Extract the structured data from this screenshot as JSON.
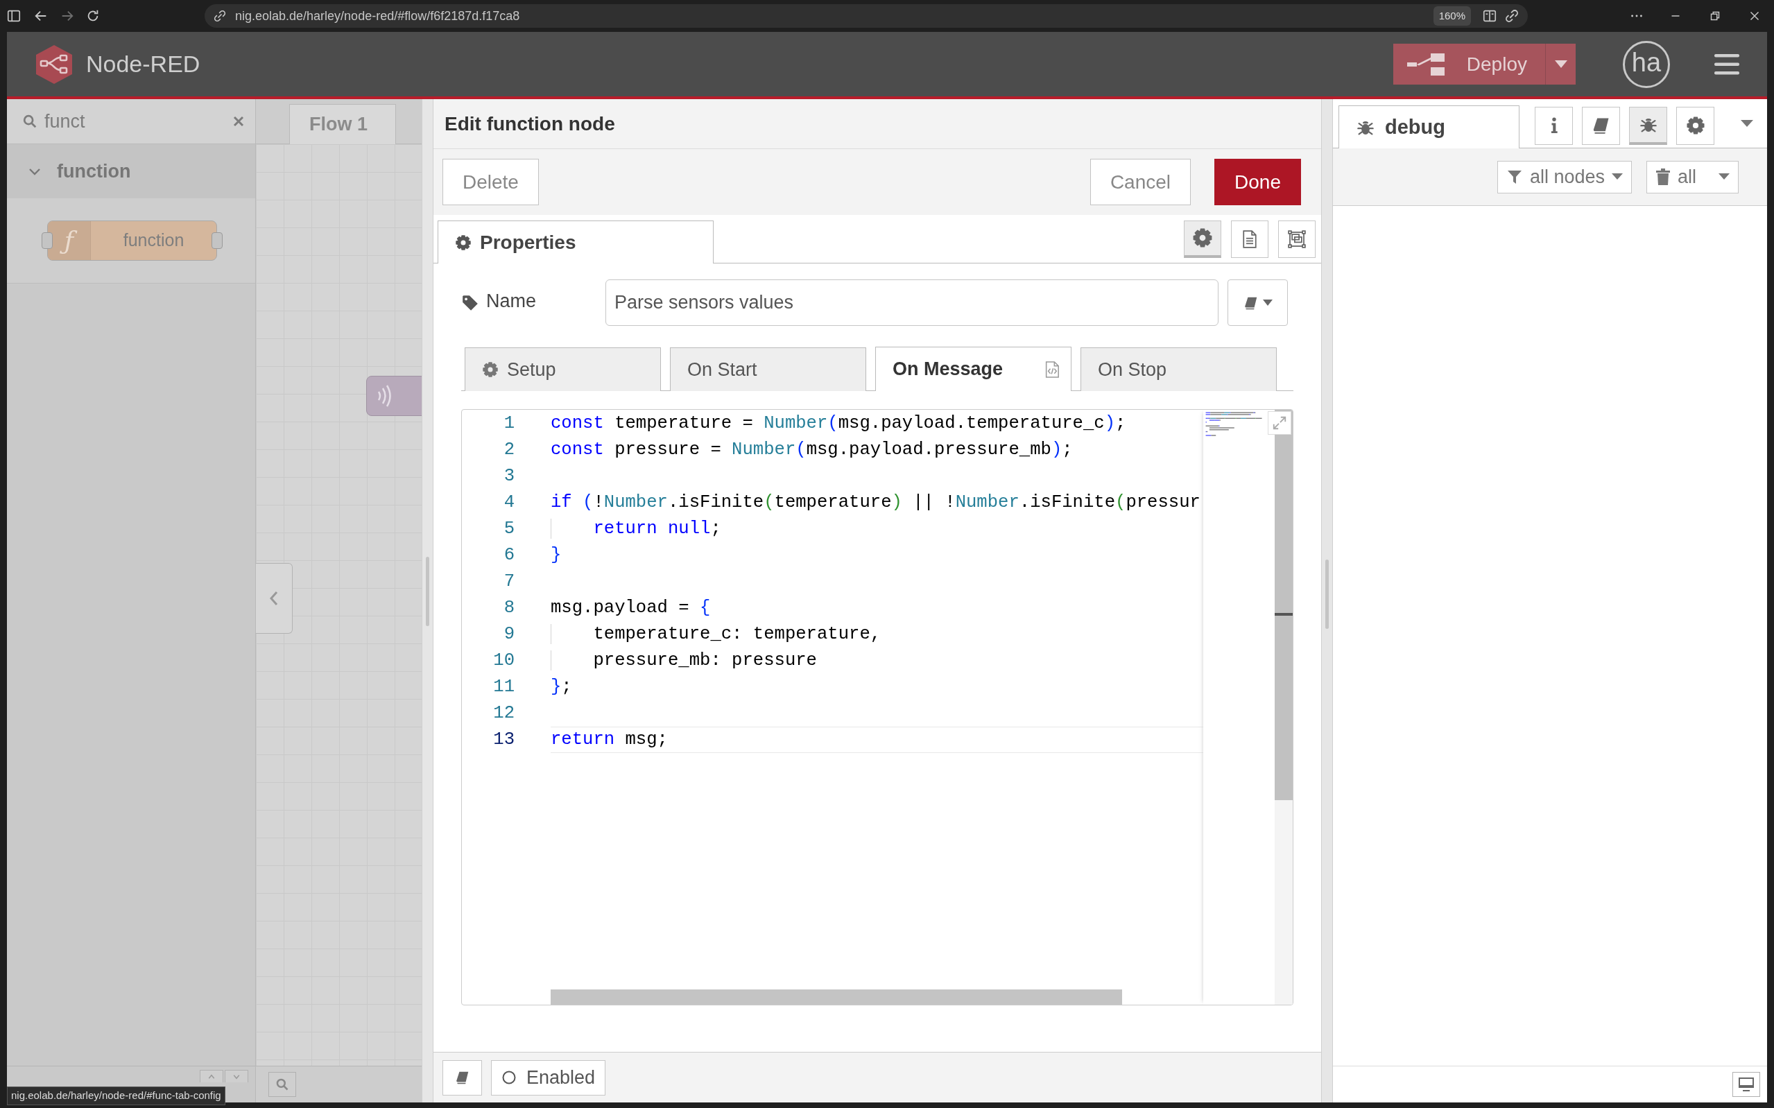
{
  "browser": {
    "url": "nig.eolab.de/harley/node-red/#flow/f6f2187d.f17ca8",
    "zoom": "160%",
    "status_url": "nig.eolab.de/harley/node-red/#func-tab-config"
  },
  "header": {
    "title": "Node-RED",
    "deploy": "Deploy",
    "user": "ha"
  },
  "palette": {
    "search": {
      "value": "funct"
    },
    "categories": [
      {
        "label": "function",
        "expanded": true,
        "nodes": [
          {
            "label": "function",
            "icon": "ƒ"
          }
        ]
      }
    ]
  },
  "workspace": {
    "tabs": [
      {
        "label": "Flow 1",
        "selected": true
      }
    ]
  },
  "tray": {
    "title": "Edit function node",
    "buttons_left": [
      {
        "label": "Delete",
        "kind": "default"
      }
    ],
    "buttons_right": [
      {
        "label": "Cancel",
        "kind": "default"
      },
      {
        "label": "Done",
        "kind": "primary"
      }
    ],
    "tabs": [
      {
        "label": "Properties",
        "selected": true
      }
    ],
    "tool_tabs": [
      {
        "kind": "gear",
        "selected": true
      },
      {
        "kind": "document",
        "selected": false
      },
      {
        "kind": "frame",
        "selected": false
      }
    ],
    "name": {
      "label": "Name",
      "value": "Parse sensors values"
    },
    "subtabs": [
      {
        "label": "Setup",
        "kind": "gear",
        "selected": false
      },
      {
        "label": "On Start",
        "kind": "plain",
        "selected": false
      },
      {
        "label": "On Message",
        "kind": "code",
        "selected": true
      },
      {
        "label": "On Stop",
        "kind": "plain",
        "selected": false
      }
    ],
    "editor": {
      "lines": [
        {
          "number": "1",
          "current": false,
          "tokens": [
            {
              "kind": "keyword",
              "text": "const"
            },
            {
              "kind": "plain",
              "text": " temperature = "
            },
            {
              "kind": "type",
              "text": "Number"
            },
            {
              "kind": "bracket1",
              "text": "("
            },
            {
              "kind": "plain",
              "text": "msg.payload.temperature_c"
            },
            {
              "kind": "bracket1",
              "text": ")"
            },
            {
              "kind": "plain",
              "text": ";"
            }
          ]
        },
        {
          "number": "2",
          "current": false,
          "tokens": [
            {
              "kind": "keyword",
              "text": "const"
            },
            {
              "kind": "plain",
              "text": " pressure = "
            },
            {
              "kind": "type",
              "text": "Number"
            },
            {
              "kind": "bracket1",
              "text": "("
            },
            {
              "kind": "plain",
              "text": "msg.payload.pressure_mb"
            },
            {
              "kind": "bracket1",
              "text": ")"
            },
            {
              "kind": "plain",
              "text": ";"
            }
          ]
        },
        {
          "number": "3",
          "current": false
        },
        {
          "number": "4",
          "current": false,
          "tokens": [
            {
              "kind": "keyword",
              "text": "if"
            },
            {
              "kind": "bracket1",
              "text": " ("
            },
            {
              "kind": "plain",
              "text": "!"
            },
            {
              "kind": "type",
              "text": "Number"
            },
            {
              "kind": "plain",
              "text": ".isFinite"
            },
            {
              "kind": "bracket2",
              "text": "("
            },
            {
              "kind": "plain",
              "text": "temperature"
            },
            {
              "kind": "bracket2",
              "text": ")"
            },
            {
              "kind": "plain",
              "text": " || !"
            },
            {
              "kind": "type",
              "text": "Number"
            },
            {
              "kind": "plain",
              "text": ".isFinite"
            },
            {
              "kind": "bracket2",
              "text": "("
            },
            {
              "kind": "plain",
              "text": "pressur"
            }
          ]
        },
        {
          "number": "5",
          "current": false,
          "indent_guide": true,
          "tokens": [
            {
              "kind": "keyword",
              "text": "return"
            },
            {
              "kind": "keyword",
              "text": " null"
            },
            {
              "kind": "plain",
              "text": ";"
            }
          ]
        },
        {
          "number": "6",
          "current": false,
          "tokens": [
            {
              "kind": "bracket1",
              "text": "}"
            }
          ]
        },
        {
          "number": "7",
          "current": false
        },
        {
          "number": "8",
          "current": false,
          "tokens": [
            {
              "kind": "plain",
              "text": "msg.payload = "
            },
            {
              "kind": "bracket1",
              "text": "{"
            }
          ]
        },
        {
          "number": "9",
          "current": false,
          "indent_guide": true,
          "tokens": [
            {
              "kind": "plain",
              "text": "temperature_c: temperature,"
            }
          ]
        },
        {
          "number": "10",
          "current": false,
          "indent_guide": true,
          "tokens": [
            {
              "kind": "plain",
              "text": "pressure_mb: pressure"
            }
          ]
        },
        {
          "number": "11",
          "current": false,
          "tokens": [
            {
              "kind": "bracket1",
              "text": "}"
            },
            {
              "kind": "plain",
              "text": ";"
            }
          ]
        },
        {
          "number": "12",
          "current": false
        },
        {
          "number": "13",
          "current": true,
          "tokens": [
            {
              "kind": "keyword",
              "text": "return"
            },
            {
              "kind": "plain",
              "text": " msg;"
            }
          ]
        }
      ]
    },
    "enabled": {
      "label": "Enabled",
      "checked": false
    }
  },
  "sidebar": {
    "tabs": [
      {
        "label": "debug",
        "selected": true
      }
    ],
    "tool_tabs": [
      {
        "kind": "info",
        "selected": false
      },
      {
        "kind": "book",
        "selected": false
      },
      {
        "kind": "bug",
        "selected": true
      },
      {
        "kind": "gear",
        "selected": false
      }
    ],
    "filter": "all nodes",
    "clear": "all"
  }
}
